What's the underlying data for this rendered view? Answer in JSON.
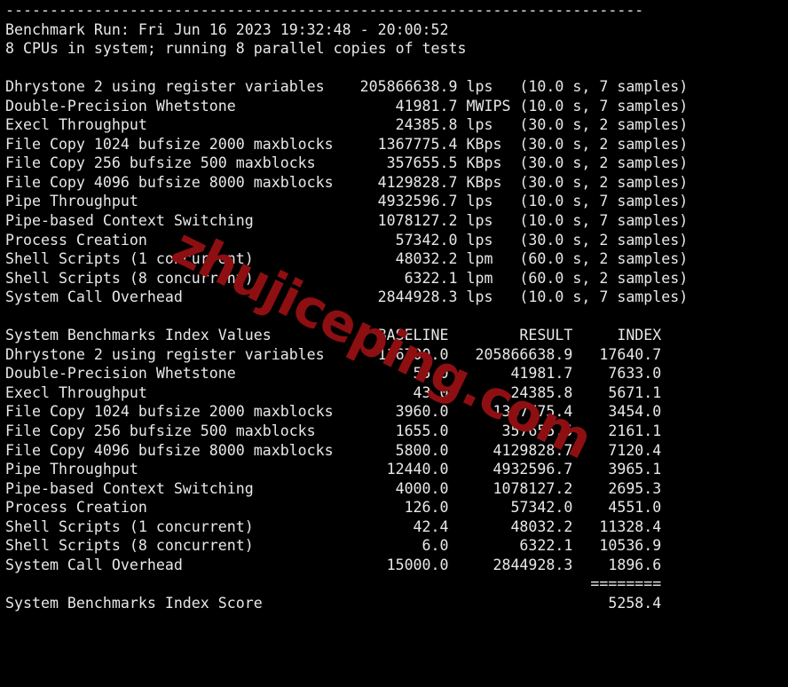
{
  "terminal": {
    "background_color": "#000000",
    "text_color": "#e8e8e8",
    "rule_top": "------------------------------------------------------------------------",
    "header": {
      "run_line": "Benchmark Run: Fri Jun 16 2023 19:32:48 - 20:00:52",
      "cpu_line": "8 CPUs in system; running 8 parallel copies of tests"
    },
    "raw_results": {
      "rows": [
        {
          "name": "Dhrystone 2 using register variables",
          "value": "205866638.9",
          "unit": "lps",
          "detail": "(10.0 s, 7 samples)"
        },
        {
          "name": "Double-Precision Whetstone",
          "value": "41981.7",
          "unit": "MWIPS",
          "detail": "(10.0 s, 7 samples)"
        },
        {
          "name": "Execl Throughput",
          "value": "24385.8",
          "unit": "lps",
          "detail": "(30.0 s, 2 samples)"
        },
        {
          "name": "File Copy 1024 bufsize 2000 maxblocks",
          "value": "1367775.4",
          "unit": "KBps",
          "detail": "(30.0 s, 2 samples)"
        },
        {
          "name": "File Copy 256 bufsize 500 maxblocks",
          "value": "357655.5",
          "unit": "KBps",
          "detail": "(30.0 s, 2 samples)"
        },
        {
          "name": "File Copy 4096 bufsize 8000 maxblocks",
          "value": "4129828.7",
          "unit": "KBps",
          "detail": "(30.0 s, 2 samples)"
        },
        {
          "name": "Pipe Throughput",
          "value": "4932596.7",
          "unit": "lps",
          "detail": "(10.0 s, 7 samples)"
        },
        {
          "name": "Pipe-based Context Switching",
          "value": "1078127.2",
          "unit": "lps",
          "detail": "(10.0 s, 7 samples)"
        },
        {
          "name": "Process Creation",
          "value": "57342.0",
          "unit": "lps",
          "detail": "(30.0 s, 2 samples)"
        },
        {
          "name": "Shell Scripts (1 concurrent)",
          "value": "48032.2",
          "unit": "lpm",
          "detail": "(60.0 s, 2 samples)"
        },
        {
          "name": "Shell Scripts (8 concurrent)",
          "value": "6322.1",
          "unit": "lpm",
          "detail": "(60.0 s, 2 samples)"
        },
        {
          "name": "System Call Overhead",
          "value": "2844928.3",
          "unit": "lps",
          "detail": "(10.0 s, 7 samples)"
        }
      ]
    },
    "index_table": {
      "title": "System Benchmarks Index Values",
      "columns": [
        "BASELINE",
        "RESULT",
        "INDEX"
      ],
      "rows": [
        {
          "name": "Dhrystone 2 using register variables",
          "baseline": "116700.0",
          "result": "205866638.9",
          "index": "17640.7"
        },
        {
          "name": "Double-Precision Whetstone",
          "baseline": "55.0",
          "result": "41981.7",
          "index": "7633.0"
        },
        {
          "name": "Execl Throughput",
          "baseline": "43.0",
          "result": "24385.8",
          "index": "5671.1"
        },
        {
          "name": "File Copy 1024 bufsize 2000 maxblocks",
          "baseline": "3960.0",
          "result": "1367775.4",
          "index": "3454.0"
        },
        {
          "name": "File Copy 256 bufsize 500 maxblocks",
          "baseline": "1655.0",
          "result": "357655.5",
          "index": "2161.1"
        },
        {
          "name": "File Copy 4096 bufsize 8000 maxblocks",
          "baseline": "5800.0",
          "result": "4129828.7",
          "index": "7120.4"
        },
        {
          "name": "Pipe Throughput",
          "baseline": "12440.0",
          "result": "4932596.7",
          "index": "3965.1"
        },
        {
          "name": "Pipe-based Context Switching",
          "baseline": "4000.0",
          "result": "1078127.2",
          "index": "2695.3"
        },
        {
          "name": "Process Creation",
          "baseline": "126.0",
          "result": "57342.0",
          "index": "4551.0"
        },
        {
          "name": "Shell Scripts (1 concurrent)",
          "baseline": "42.4",
          "result": "48032.2",
          "index": "11328.4"
        },
        {
          "name": "Shell Scripts (8 concurrent)",
          "baseline": "6.0",
          "result": "6322.1",
          "index": "10536.9"
        },
        {
          "name": "System Call Overhead",
          "baseline": "15000.0",
          "result": "2844928.3",
          "index": "1896.6"
        }
      ],
      "separator": "========",
      "score_label": "System Benchmarks Index Score",
      "score_value": "5258.4"
    }
  },
  "watermark": {
    "text": "zhujiceping.com",
    "color": "#8d0f12"
  }
}
